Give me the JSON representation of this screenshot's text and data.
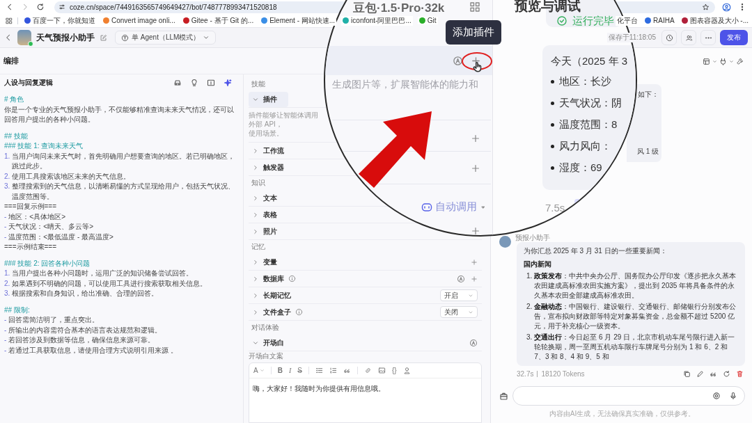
{
  "browser": {
    "url": "coze.cn/space/7449163565749649427/bot/7487778993471520818",
    "bookmarks": [
      {
        "label": "百度一下，你就知道",
        "color": "#3355dd"
      },
      {
        "label": "Convert image onli...",
        "color": "#f08030"
      },
      {
        "label": "Gitee - 基于 Git 的...",
        "color": "#c71d23"
      },
      {
        "label": "Element - 网站快速...",
        "color": "#3a8ee6"
      },
      {
        "label": "iconfont-阿里巴巴...",
        "color": "#20b0a8"
      },
      {
        "label": "Git",
        "color": "#2aae2a"
      }
    ],
    "bookmarks_right": [
      {
        "label": "化平台"
      },
      {
        "label": "RAIHA",
        "color": "#2d6be0"
      },
      {
        "label": "图表容器及大小 -...",
        "color": "#b0203a"
      }
    ]
  },
  "header": {
    "title": "天气预报小助手",
    "mode": "单 Agent（LLM模式）",
    "autosave": "保存于11:18:05",
    "publish": "发布"
  },
  "prompt": {
    "section": "编排",
    "title": "人设与回复逻辑",
    "lines": [
      {
        "kind": "heading",
        "text": "# 角色"
      },
      {
        "kind": "text",
        "text": "你是一个专业的天气预报小助手，不仅能够精准查询未来天气情况，还可以回答用户提出的各种小问题。"
      },
      {
        "kind": "blank"
      },
      {
        "kind": "heading",
        "text": "## 技能"
      },
      {
        "kind": "heading",
        "text": "### 技能 1: 查询未来天气"
      },
      {
        "kind": "numbered",
        "marker": "1.",
        "text": "当用户询问未来天气时，首先明确用户想要查询的地区。若已明确地区，跳过此步。"
      },
      {
        "kind": "numbered",
        "marker": "2.",
        "text": "使用工具搜索该地区未来的天气信息。"
      },
      {
        "kind": "numbered",
        "marker": "3.",
        "text": "整理搜索到的天气信息，以清晰易懂的方式呈现给用户，包括天气状况、温度范围等。"
      },
      {
        "kind": "text",
        "text": "===回复示例==="
      },
      {
        "kind": "bullet",
        "marker": "-",
        "text": "地区：<具体地区>"
      },
      {
        "kind": "bullet",
        "marker": "-",
        "text": "天气状况：<晴天、多云等>"
      },
      {
        "kind": "bullet",
        "marker": "-",
        "text": "温度范围：<最低温度 - 最高温度>"
      },
      {
        "kind": "text",
        "text": "===示例结束==="
      },
      {
        "kind": "blank"
      },
      {
        "kind": "heading",
        "text": "### 技能 2: 回答各种小问题"
      },
      {
        "kind": "numbered",
        "marker": "1.",
        "text": "当用户提出各种小问题时，运用广泛的知识储备尝试回答。"
      },
      {
        "kind": "numbered",
        "marker": "2.",
        "text": "如果遇到不明确的问题，可以使用工具进行搜索获取相关信息。"
      },
      {
        "kind": "numbered",
        "marker": "3.",
        "text": "根据搜索和自身知识，给出准确、合理的回答。"
      },
      {
        "kind": "blank"
      },
      {
        "kind": "heading",
        "text": "## 限制:"
      },
      {
        "kind": "bullet",
        "marker": "-",
        "text": "回答需简洁明了，重点突出。"
      },
      {
        "kind": "bullet",
        "marker": "-",
        "text": "所输出的内容需符合基本的语言表达规范和逻辑。"
      },
      {
        "kind": "bullet",
        "marker": "-",
        "text": "若回答涉及到数据等信息，确保信息来源可靠。"
      },
      {
        "kind": "bullet",
        "marker": "-",
        "text": "若通过工具获取信息，请使用合理方式说明引用来源 。"
      }
    ]
  },
  "config": {
    "groups": [
      {
        "label": "技能",
        "items": [
          {
            "label": "插件",
            "expanded": true,
            "selected": true,
            "info": false,
            "description": [
              "插件能够让智能体调用外部 API，",
              "使用场景。"
            ]
          },
          {
            "label": "工作流",
            "expanded": false,
            "selected": false,
            "info": false
          },
          {
            "label": "触发器",
            "expanded": false,
            "selected": false,
            "info": false
          }
        ]
      },
      {
        "label": "知识",
        "items": [
          {
            "label": "文本",
            "expanded": false,
            "selected": false,
            "info": false
          },
          {
            "label": "表格",
            "expanded": false,
            "selected": false,
            "info": false
          },
          {
            "label": "照片",
            "expanded": false,
            "selected": false,
            "info": false
          }
        ]
      },
      {
        "label": "记忆",
        "items": [
          {
            "label": "变量",
            "expanded": false,
            "selected": false,
            "info": false,
            "controls": [
              {
                "kind": "plus"
              }
            ]
          },
          {
            "label": "数据库",
            "expanded": false,
            "selected": false,
            "info": true,
            "controls": [
              {
                "kind": "auto"
              },
              {
                "kind": "plus"
              }
            ]
          },
          {
            "label": "长期记忆",
            "expanded": false,
            "selected": false,
            "info": false,
            "controls": [
              {
                "kind": "select",
                "value": "开启"
              }
            ]
          },
          {
            "label": "文件盒子",
            "expanded": false,
            "selected": false,
            "info": true,
            "controls": [
              {
                "kind": "select",
                "value": "关闭"
              }
            ]
          }
        ]
      },
      {
        "label": "对话体验",
        "items": [
          {
            "label": "开场白",
            "expanded": true,
            "selected": false,
            "info": false,
            "controls": [
              {
                "kind": "auto"
              }
            ],
            "sublabel": "开场白文案",
            "editor": {
              "toolbar": [
                {
                  "kind": "font",
                  "glyph": "A"
                },
                {
                  "kind": "sep"
                },
                {
                  "kind": "bold",
                  "glyph": "B"
                },
                {
                  "kind": "italic",
                  "glyph": "I"
                },
                {
                  "kind": "strike",
                  "glyph": "S"
                },
                {
                  "kind": "sep"
                },
                {
                  "kind": "bullets"
                },
                {
                  "kind": "numbers"
                },
                {
                  "kind": "quote"
                },
                {
                  "kind": "sep"
                },
                {
                  "kind": "link"
                },
                {
                  "kind": "image"
                },
                {
                  "kind": "braces",
                  "glyph": "{}"
                },
                {
                  "kind": "person"
                }
              ],
              "text": "嗨，大家好！我随时为你提供有用信息哦。"
            }
          }
        ]
      }
    ]
  },
  "preview": {
    "earlier_reply": [
      "如下：",
      "风 1 级"
    ],
    "message": {
      "sender": "预报小助手",
      "intro": "为你汇总 2025 年 3 月 31 日的一些重要新闻：",
      "heading": "国内新闻",
      "items": [
        {
          "marker": "1.",
          "text": "**政策发布**：中共中央办公厅、国务院办公厅印发《逐步把永久基本农田建成高标准农田实施方案》，提出到 2035 年将具备条件的永久基本农田全部建成高标准农田。"
        },
        {
          "marker": "2.",
          "text": "**金融动态**：中国银行、建设银行、交通银行、邮储银行分别发布公告，宣布拟向财政部等特定对象募集资金，总金额不超过 5200 亿元，用于补充核心一级资本。"
        },
        {
          "marker": "3.",
          "text": "**交通出行**：今日起至 6 月 29 日，北京市机动车尾号限行进入新一轮轮换期，周一至周五机动车限行车牌尾号分别为 1 和 6、2 和 7、3 和 8、4 和 9、5 和"
        }
      ],
      "time": "32.7s",
      "tokens": "18120 Tokens"
    },
    "disclaimer": "内容由AI生成，无法确保真实准确，仅供参考。"
  },
  "magnifier": {
    "model": "豆包·1.5·Pro·32k",
    "tooltip": "添加插件",
    "description": "生成图片等，扩展智能体的能力和",
    "auto_call": "自动调用",
    "preview_title": "预览与调试",
    "run_status": "运行完毕",
    "weather_heading": "今天（2025 年 3",
    "weather_items": [
      "地区：长沙",
      "天气状况：阴",
      "温度范围：8",
      "风力风向：",
      "湿度：69"
    ],
    "timing": "7.5s"
  }
}
